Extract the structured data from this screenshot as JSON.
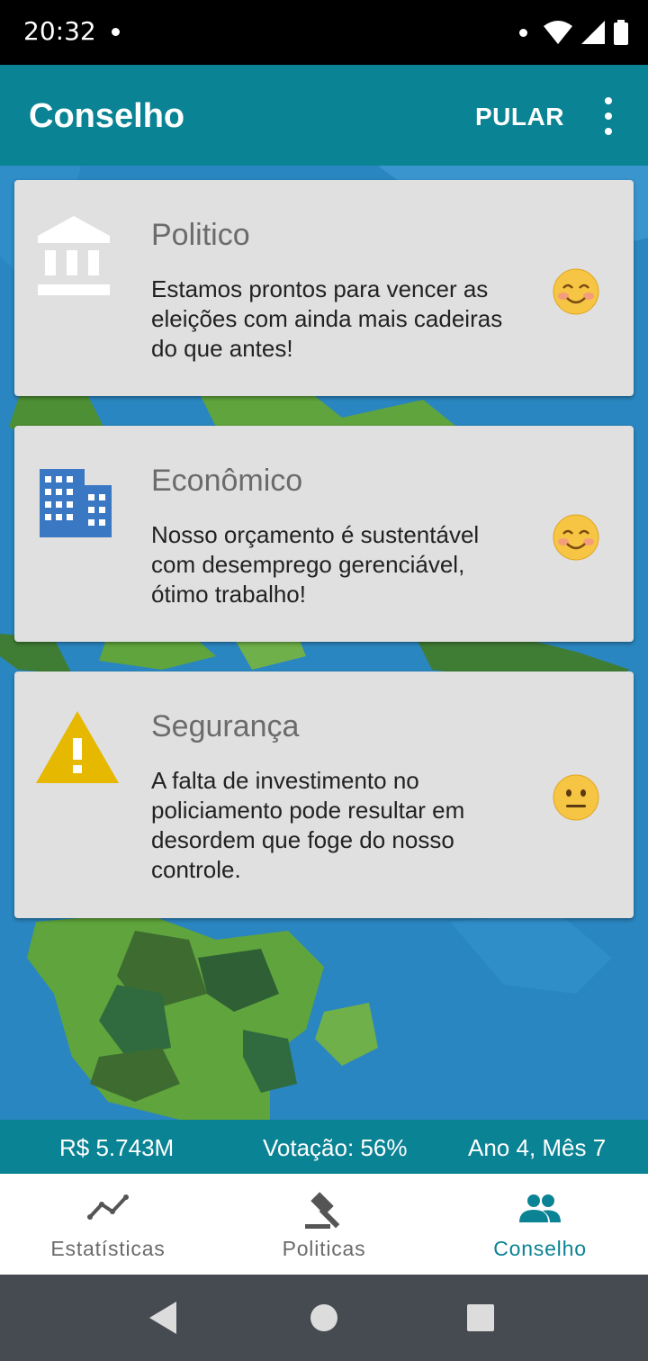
{
  "status_bar": {
    "time": "20:32"
  },
  "app_bar": {
    "title": "Conselho",
    "skip_label": "PULAR"
  },
  "advisors": [
    {
      "title": "Politico",
      "message": "Estamos prontos para vencer as eleições com ainda mais cadeiras do que antes!",
      "icon": "bank-icon",
      "mood": "smiling-face-icon"
    },
    {
      "title": "Econômico",
      "message": "Nosso orçamento é sustentável com desemprego gerenciável, ótimo trabalho!",
      "icon": "building-icon",
      "mood": "smiling-face-icon"
    },
    {
      "title": "Segurança",
      "message": "A falta de investimento no policiamento pode resultar em desordem que foge do nosso controle.",
      "icon": "warning-icon",
      "mood": "neutral-face-icon"
    }
  ],
  "info_bar": {
    "money": "R$ 5.743M",
    "vote": "Votação: 56%",
    "date": "Ano 4, Mês 7"
  },
  "bottom_nav": [
    {
      "label": "Estatísticas",
      "icon": "trending-icon",
      "active": false
    },
    {
      "label": "Politicas",
      "icon": "gavel-icon",
      "active": false
    },
    {
      "label": "Conselho",
      "icon": "people-icon",
      "active": true
    }
  ],
  "colors": {
    "primary": "#0a8394",
    "card": "#e0e0e0",
    "sea": "#2a86c0",
    "land": "#5fa43c",
    "warning": "#e6b800",
    "building": "#3b78c4"
  }
}
